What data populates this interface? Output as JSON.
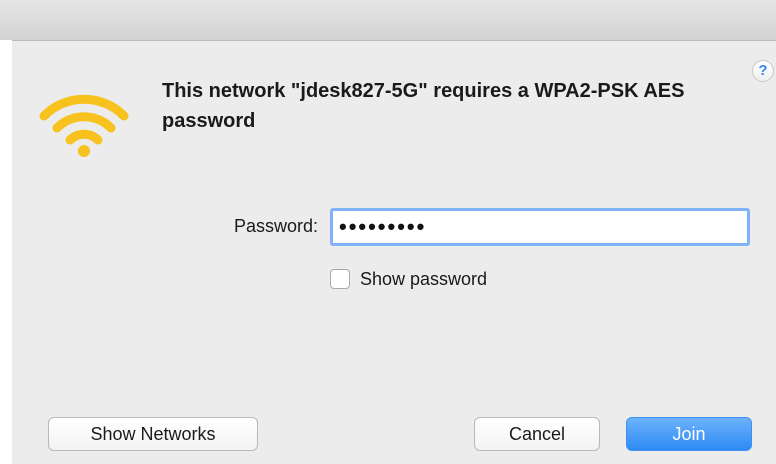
{
  "dialog": {
    "heading": "This network \"jdesk827-5G\" requires a WPA2-PSK AES password",
    "help_label": "?",
    "wifi_icon": "wifi-icon",
    "colors": {
      "wifi": "#f7c21e",
      "accent": "#3a86f5"
    }
  },
  "form": {
    "password_label": "Password:",
    "password_value": "•••••••••",
    "show_password_label": "Show password",
    "show_password_checked": false
  },
  "buttons": {
    "show_networks": "Show Networks",
    "cancel": "Cancel",
    "join": "Join"
  }
}
